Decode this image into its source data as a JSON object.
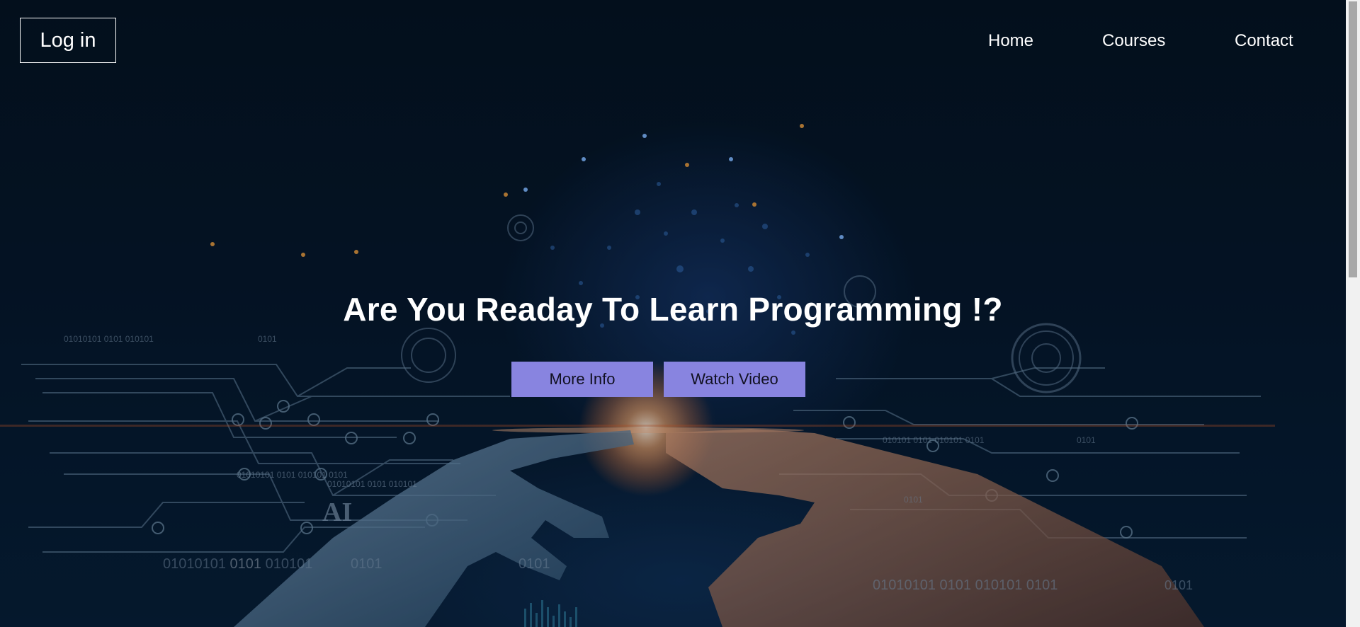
{
  "header": {
    "login_label": "Log in",
    "nav": {
      "home": "Home",
      "courses": "Courses",
      "contact": "Contact"
    }
  },
  "hero": {
    "title": "Are You Readay To Learn Programming !?",
    "more_info_label": "More Info",
    "watch_video_label": "Watch Video"
  },
  "background": {
    "ai_label": "AI",
    "binary_1": "01010101 0101 010101",
    "binary_2": "0101",
    "binary_3": "01010101 0101 010101  0101",
    "binary_4": "0101",
    "binary_5": "01010101 0101 010101",
    "binary_6": "0101",
    "binary_7": "0101",
    "binary_8": "010101 0101 010101 0101",
    "binary_9": "0101",
    "binary_10": "01010101 0101 010101 0101",
    "binary_11": "0101"
  },
  "colors": {
    "button_bg": "#8884e0",
    "text": "#ffffff",
    "background": "#041529"
  }
}
